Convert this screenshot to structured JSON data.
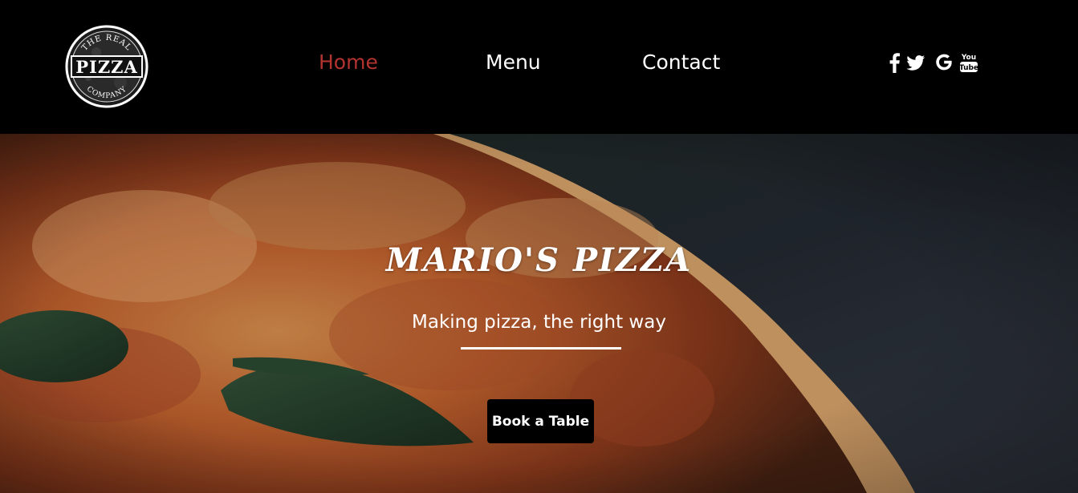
{
  "logo": {
    "top_text": "THE REAL",
    "main_text": "PIZZA",
    "bottom_text": "COMPANY"
  },
  "nav": {
    "items": [
      {
        "label": "Home",
        "active": true
      },
      {
        "label": "Menu",
        "active": false
      },
      {
        "label": "Contact",
        "active": false
      }
    ],
    "active_color": "#b3342f",
    "color": "#ffffff"
  },
  "social": {
    "icons": [
      "facebook-icon",
      "twitter-icon",
      "google-icon",
      "youtube-icon"
    ],
    "youtube_top": "You",
    "youtube_bottom": "Tube"
  },
  "hero": {
    "title": "MARIO'S PIZZA",
    "subtitle": "Making pizza, the right way",
    "button_label": "Book a Table"
  }
}
